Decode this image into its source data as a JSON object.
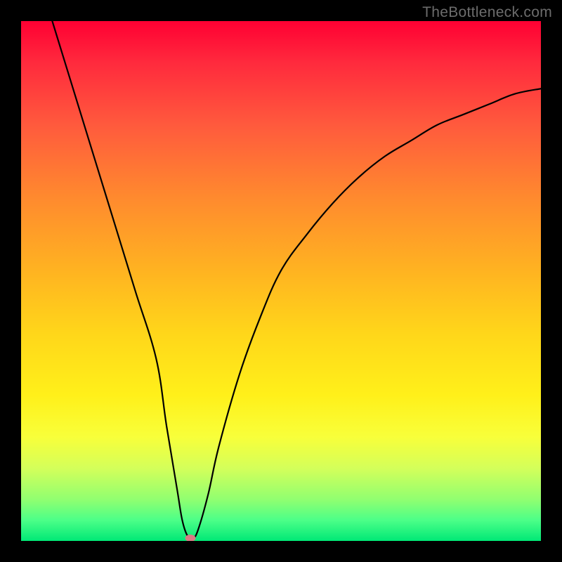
{
  "watermark": "TheBottleneck.com",
  "chart_data": {
    "type": "line",
    "title": "",
    "xlabel": "",
    "ylabel": "",
    "xlim": [
      0,
      100
    ],
    "ylim": [
      0,
      100
    ],
    "series": [
      {
        "name": "bottleneck-curve",
        "x": [
          6,
          10,
          14,
          18,
          22,
          26,
          28,
          30,
          31,
          32,
          33,
          34,
          36,
          38,
          42,
          46,
          50,
          55,
          60,
          65,
          70,
          75,
          80,
          85,
          90,
          95,
          100
        ],
        "y": [
          100,
          87,
          74,
          61,
          48,
          35,
          22,
          10,
          4,
          1,
          0.5,
          2,
          9,
          18,
          32,
          43,
          52,
          59,
          65,
          70,
          74,
          77,
          80,
          82,
          84,
          86,
          87
        ]
      }
    ],
    "marker": {
      "x": 32.5,
      "y": 0.5
    },
    "background_gradient": {
      "top": "#ff0033",
      "mid": "#ffd61a",
      "bottom": "#00e876"
    }
  }
}
